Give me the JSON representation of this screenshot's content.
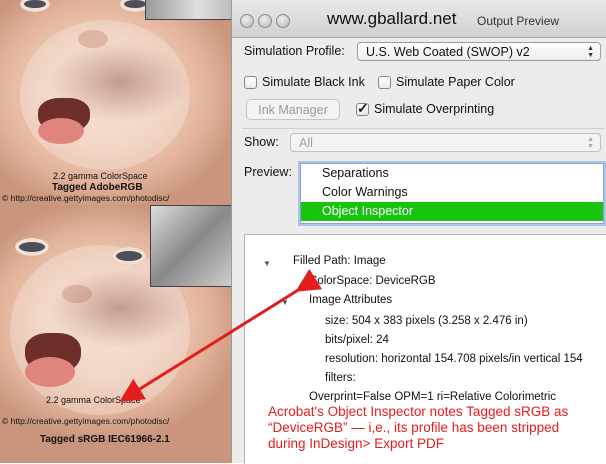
{
  "photos": {
    "top_caption_line1": "2.2 gamma ColorSpace",
    "top_caption_line2": "Tagged AdobeRGB",
    "top_credit": "© http://creative.gettyimages.com/photodisc/",
    "bottom_caption_line1": "2.2 gamma ColorSpace",
    "bottom_credit": "© http://creative.gettyimages.com/photodisc/",
    "bottom_caption_line2": "Tagged sRGB IEC61966-2.1"
  },
  "window": {
    "site_title": "www.gballard.net",
    "title": "Output Preview"
  },
  "simulation": {
    "profile_label": "Simulation Profile:",
    "profile_value": "U.S. Web Coated (SWOP) v2",
    "black_ink_label": "Simulate Black Ink",
    "black_ink_checked": false,
    "paper_color_label": "Simulate Paper Color",
    "paper_color_checked": false,
    "ink_manager_label": "Ink Manager",
    "overprinting_label": "Simulate Overprinting",
    "overprinting_checked": true
  },
  "show": {
    "label": "Show:",
    "value": "All"
  },
  "preview": {
    "label": "Preview:",
    "items": [
      "Separations",
      "Color Warnings",
      "Object Inspector"
    ],
    "selected": "Object Inspector"
  },
  "inspector": {
    "filled_path": "Filled Path: Image",
    "colorspace": "ColorSpace: DeviceRGB",
    "image_attributes": "Image Attributes",
    "size": "size: 504 x 383 pixels (3.258 x 2.476 in)",
    "bits": "bits/pixel: 24",
    "resolution": "resolution: horizontal 154.708 pixels/in vertical 154",
    "filters": "filters:",
    "overprint": "Overprint=False OPM=1 ri=Relative Colorimetric"
  },
  "annotation": {
    "text": "Acrobat's Object Inspector notes Tagged sRGB as “DeviceRGB” — i,e., its profile has been stripped during InDesign> Export PDF",
    "color": "#e31d1d"
  },
  "colors": {
    "selection": "#17c50f",
    "arrow": "#e31d1d"
  }
}
